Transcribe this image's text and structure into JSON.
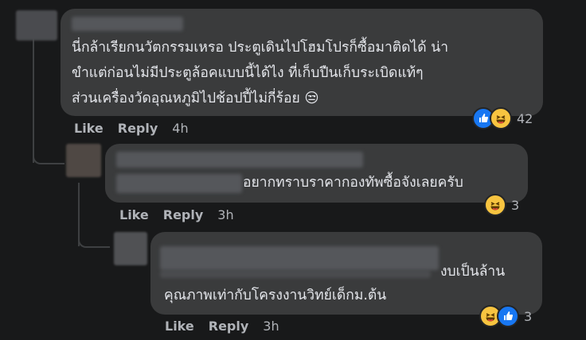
{
  "comments": [
    {
      "text_lines": [
        "นี่กล้าเรียกนวัตกรรมเหรอ ประตูเดินไปโฮมโปรก็ซื้อมาติดได้ น่า",
        "ขำแต่ก่อนไม่มีประตูล้อคแบบนี้ได้ไง ที่เก็บปืนเก็บระเบิดแท้ๆ",
        "ส่วนเครื่องวัดอุณหภูมิไปช้อปปี้ไม่กี่ร้อย 😒"
      ],
      "like_label": "Like",
      "reply_label": "Reply",
      "time": "4h",
      "reaction_count": "42",
      "reactions": [
        "like-icon",
        "haha-icon"
      ]
    },
    {
      "text_lines": [
        "อยากทราบราคากองทัพซื้อจังเลยครับ"
      ],
      "like_label": "Like",
      "reply_label": "Reply",
      "time": "3h",
      "reaction_count": "3",
      "reactions": [
        "haha-icon"
      ]
    },
    {
      "text_lines": [
        "งบเป็นล้าน",
        "คุณภาพเท่ากับโครงงานวิทย์เด็กม.ต้น"
      ],
      "like_label": "Like",
      "reply_label": "Reply",
      "time": "3h",
      "reaction_count": "3",
      "reactions": [
        "haha-icon",
        "like-icon"
      ]
    }
  ],
  "colors": {
    "background": "#18191a",
    "bubble": "#3a3b3c",
    "text": "#e4e6eb",
    "muted": "#b0b3b8",
    "like_blue": "#1877f2",
    "haha_yellow": "#f7c440"
  }
}
